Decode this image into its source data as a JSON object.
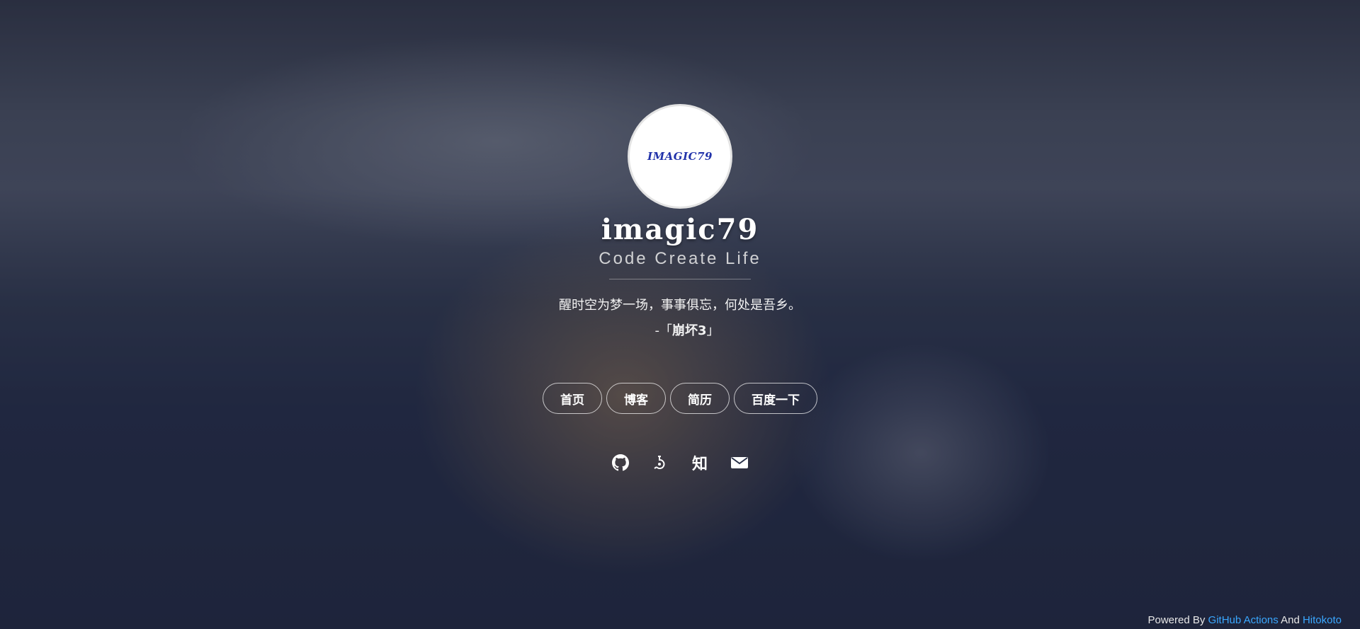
{
  "profile": {
    "avatar_text": "IMAGIC79",
    "name": "imagic79",
    "tagline": "Code Create Life"
  },
  "quote": {
    "text": "醒时空为梦一场，事事俱忘，何处是吾乡。",
    "prefix": "-「",
    "source": "崩坏3",
    "suffix": "」"
  },
  "nav": [
    {
      "label": "首页"
    },
    {
      "label": "博客"
    },
    {
      "label": "简历"
    },
    {
      "label": "百度一下"
    }
  ],
  "socials": [
    {
      "icon": "github-icon"
    },
    {
      "icon": "lab-icon"
    },
    {
      "icon": "zhihu-icon",
      "label": "知"
    },
    {
      "icon": "mail-icon"
    }
  ],
  "footer": {
    "prefix": "Powered By ",
    "link1": "GitHub Actions",
    "middle": " And ",
    "link2": "Hitokoto",
    "link_color": "#3aa7ff"
  }
}
